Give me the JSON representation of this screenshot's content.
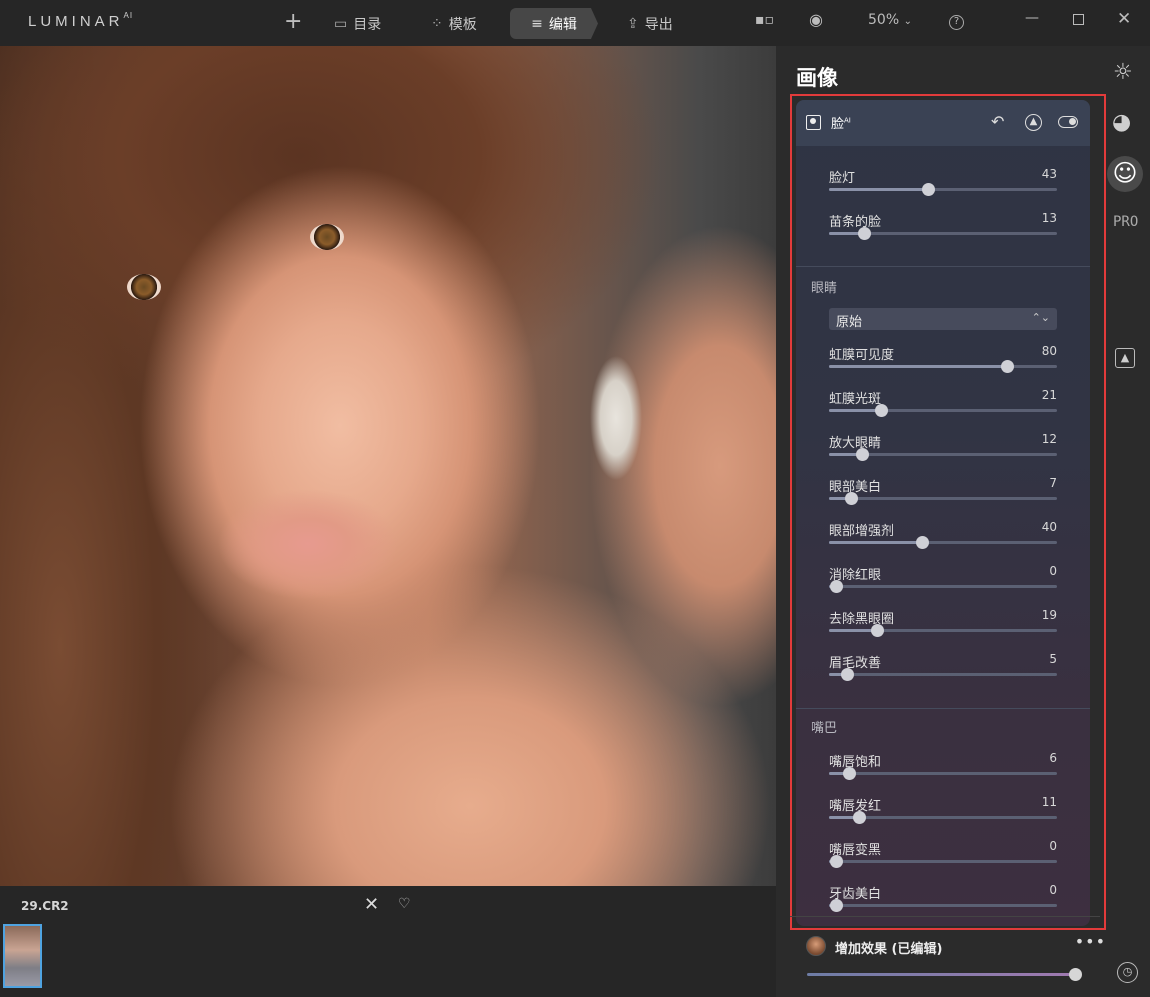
{
  "topbar": {
    "logo": "LUMINAR",
    "logo_sup": "AI",
    "add_icon": "plus-icon",
    "items": [
      {
        "icon": "folder-icon",
        "label": "目录"
      },
      {
        "icon": "sparkle-icon",
        "label": "模板"
      },
      {
        "icon": "sliders-icon",
        "label": "编辑"
      },
      {
        "icon": "share-icon",
        "label": "导出"
      }
    ],
    "zoom": "50%",
    "help": "?"
  },
  "filmstrip": {
    "filename": "29.CR2"
  },
  "panel": {
    "title": "画像",
    "tool": {
      "name": "脸",
      "name_sup": "AI",
      "face_sliders": [
        {
          "label": "脸灯",
          "value": 43
        },
        {
          "label": "苗条的脸",
          "value": 13
        }
      ],
      "eyes_label": "眼睛",
      "eyes_dropdown": "原始",
      "eye_sliders": [
        {
          "label": "虹膜可见度",
          "value": 80
        },
        {
          "label": "虹膜光斑",
          "value": 21
        },
        {
          "label": "放大眼睛",
          "value": 12
        },
        {
          "label": "眼部美白",
          "value": 7
        },
        {
          "label": "眼部增强剂",
          "value": 40
        },
        {
          "label": "消除红眼",
          "value": 0
        },
        {
          "label": "去除黑眼圈",
          "value": 19
        },
        {
          "label": "眉毛改善",
          "value": 5
        }
      ],
      "mouth_label": "嘴巴",
      "mouth_sliders": [
        {
          "label": "嘴唇饱和",
          "value": 6
        },
        {
          "label": "嘴唇发红",
          "value": 11
        },
        {
          "label": "嘴唇变黑",
          "value": 0
        },
        {
          "label": "牙齿美白",
          "value": 0
        }
      ]
    },
    "add_effect": "增加效果 (已编辑)",
    "amount": 100
  },
  "side_tools": [
    "sun-icon",
    "palette-icon",
    "smile-icon",
    "pro-icon",
    "portrait-bg-icon",
    "history-icon"
  ],
  "side_pro_label": "PRO"
}
